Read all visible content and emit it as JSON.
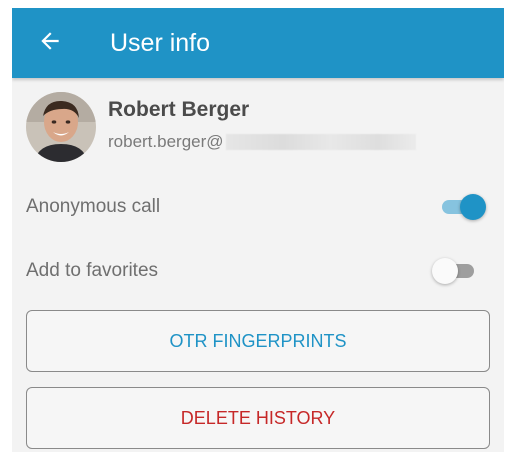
{
  "header": {
    "title": "User info",
    "back_icon": "arrow-left-icon",
    "bg_color": "#1f93c6"
  },
  "user": {
    "name": "Robert Berger",
    "email_visible": "robert.berger@"
  },
  "settings": [
    {
      "label": "Anonymous call",
      "enabled": true
    },
    {
      "label": "Add to favorites",
      "enabled": false
    }
  ],
  "actions": {
    "otr_label": "OTR FINGERPRINTS",
    "otr_color": "#1f93c6",
    "delete_label": "DELETE HISTORY",
    "delete_color": "#c62828"
  }
}
